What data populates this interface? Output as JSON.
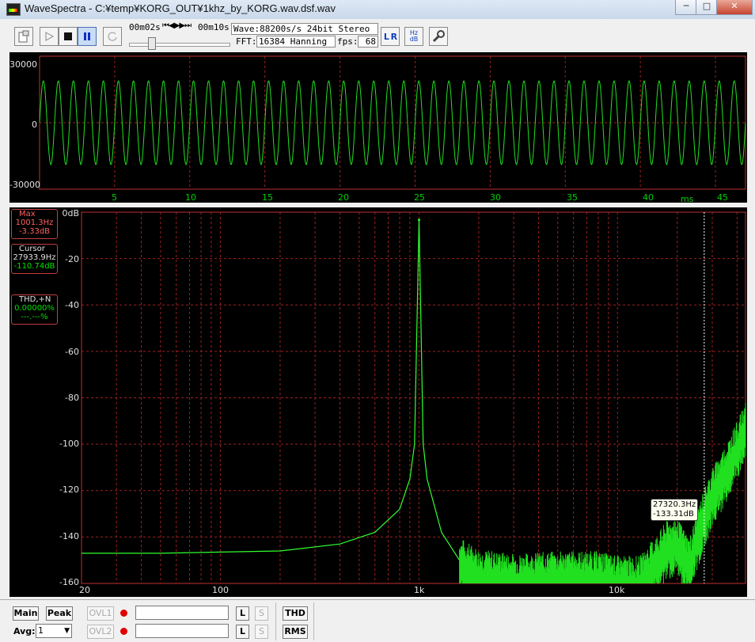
{
  "window": {
    "title": "WaveSpectra - C:¥temp¥KORG_OUT¥1khz_by_KORG.wav.dsf.wav",
    "controls": {
      "minimize": "─",
      "maximize": "□",
      "close": "✕"
    }
  },
  "toolbar": {
    "time_current": "00m02s",
    "time_total": "00m10s",
    "playback_controls": "⏮◀▶▶⏭",
    "seek_fraction": 0.2,
    "wave_info": "Wave:88200s/s 24bit Stereo",
    "fft_label": "FFT:",
    "fft_value": "16384 Hanning",
    "fps_label": "fps:",
    "fps_value": "68",
    "lr_label": "L R",
    "hz_db_label": "Hz dB"
  },
  "waveform": {
    "y_ticks": [
      "30000",
      "0",
      "-30000"
    ],
    "x_ticks": [
      "5",
      "10",
      "15",
      "20",
      "25",
      "30",
      "35",
      "40",
      "45"
    ],
    "x_unit": "ms"
  },
  "spectrum": {
    "y_ticks": [
      "0dB",
      "-20",
      "-40",
      "-60",
      "-80",
      "-100",
      "-120",
      "-140",
      "-160"
    ],
    "x_ticks": [
      "20",
      "100",
      "1k",
      "10k"
    ],
    "max": {
      "title": "Max",
      "freq": "1001.3Hz",
      "level": "-3.33dB"
    },
    "cursor": {
      "title": "Cursor",
      "freq": "27933.9Hz",
      "level": "-110.74dB"
    },
    "thd": {
      "title": "THD,+N",
      "value1": "0.00000%",
      "value2": "---.---%"
    },
    "tooltip": {
      "freq": "27320.3Hz",
      "level": "-133.31dB"
    }
  },
  "bottom": {
    "main_label": "Main",
    "peak_label": "Peak",
    "ovl1_label": "OVL1",
    "ovl2_label": "OVL2",
    "avg_label": "Avg:",
    "avg_value": "1",
    "l_label": "L",
    "s_label": "S",
    "thd_label": "THD",
    "rms_label": "RMS"
  },
  "chart_data": [
    {
      "type": "line",
      "x_unit": "ms",
      "xlim": [
        0,
        47
      ],
      "ylim": [
        -35000,
        35000
      ],
      "series": [
        {
          "frequency_hz": 1000,
          "amplitude": 22000
        }
      ]
    },
    {
      "type": "line",
      "x_scale": "log",
      "xlim": [
        20,
        44100
      ],
      "ylim": [
        -160,
        0
      ],
      "peak": {
        "x": 1001.3,
        "y": -3.33
      },
      "x": [
        20,
        50,
        100,
        200,
        400,
        600,
        800,
        900,
        950,
        1001.3,
        1050,
        1100,
        1300,
        1600,
        2000,
        3000,
        5000,
        8000,
        10000,
        13000,
        16000,
        18000,
        20000,
        23000,
        25000,
        27000,
        30000,
        35000,
        40000,
        44100
      ],
      "y": [
        -147,
        -147,
        -146.5,
        -146,
        -143,
        -138,
        -128,
        -115,
        -100,
        -3.33,
        -100,
        -115,
        -138,
        -150,
        -155,
        -157,
        -156,
        -156,
        -158,
        -158,
        -148,
        -142,
        -142,
        -150,
        -140,
        -130,
        -120,
        -110,
        -100,
        -92
      ]
    }
  ]
}
